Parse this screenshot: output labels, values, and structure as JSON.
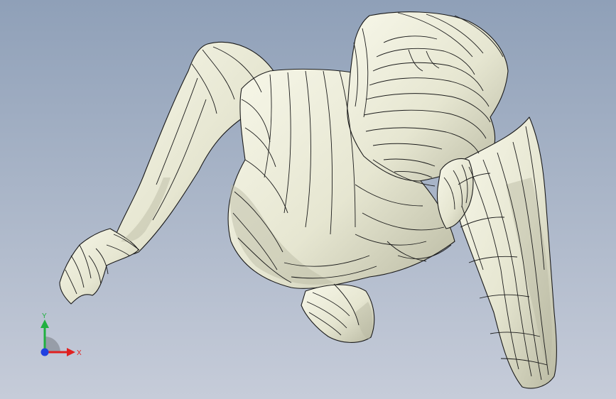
{
  "viewport": {
    "colors": {
      "background_top": "#8fa0b8",
      "background_bottom": "#c6ccd9",
      "model_fill": "#e9e9d6",
      "model_shadow": "#b9b9a2",
      "edge_lines": "#1a1a1a"
    }
  },
  "triad": {
    "x_label": "X",
    "y_label": "Y",
    "colors": {
      "x": "#e02020",
      "y": "#20b040",
      "z": "#2040e0"
    }
  }
}
